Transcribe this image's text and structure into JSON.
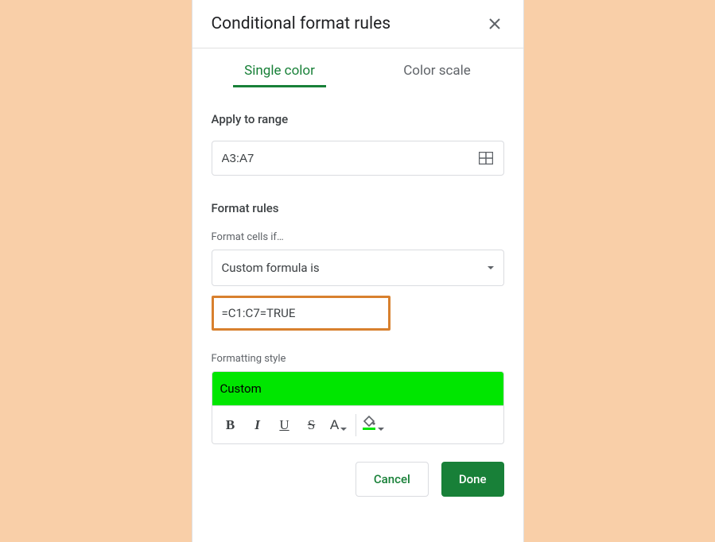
{
  "title": "Conditional format rules",
  "tabs": {
    "single_color": "Single color",
    "color_scale": "Color scale"
  },
  "sections": {
    "apply_to_range": "Apply to range",
    "format_rules": "Format rules",
    "formatting_style": "Formatting style"
  },
  "range_value": "A3:A7",
  "format_cells_if_label": "Format cells if…",
  "dropdown_value": "Custom formula is",
  "formula_value": "=C1:C7=TRUE",
  "style_preview_label": "Custom",
  "toolbar": {
    "bold": "B",
    "italic": "I",
    "underline": "U",
    "strike": "S",
    "textcolor": "A"
  },
  "buttons": {
    "cancel": "Cancel",
    "done": "Done"
  },
  "colors": {
    "preview_bg": "#00E600",
    "highlight_border": "#d8802e",
    "accent": "#188038"
  }
}
